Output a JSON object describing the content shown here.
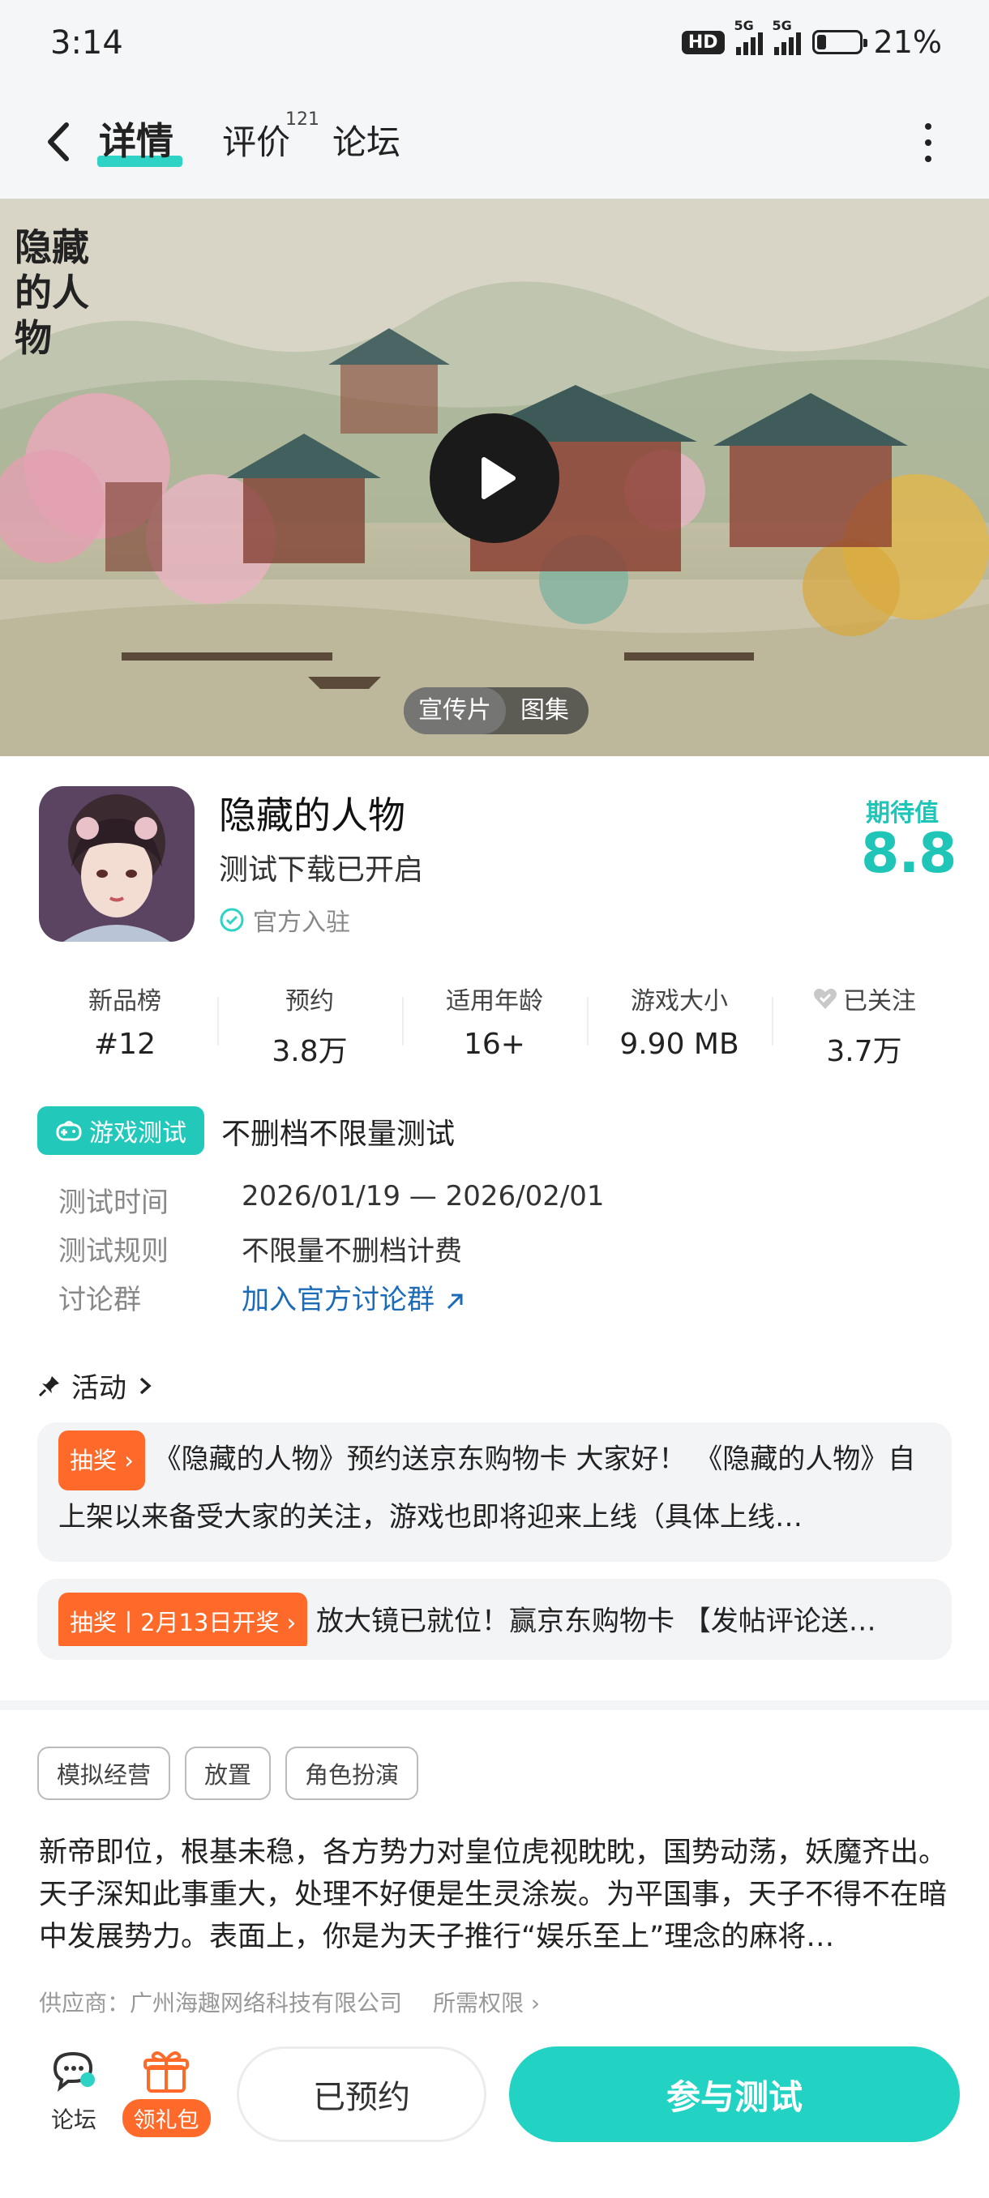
{
  "status_bar": {
    "time": "3:14",
    "hd": "HD",
    "net1": "5G",
    "net2": "5G",
    "battery_percent": 21,
    "battery_text": "21%"
  },
  "nav": {
    "tabs": [
      {
        "label": "详情",
        "active": true
      },
      {
        "label": "评价",
        "count": "121"
      },
      {
        "label": "论坛"
      }
    ]
  },
  "banner": {
    "title_art": "隐藏的人物",
    "media_tabs": [
      "宣传片",
      "图集"
    ]
  },
  "game": {
    "title": "隐藏的人物",
    "subtitle": "测试下载已开启",
    "official": "官方入驻",
    "expect_label": "期待值",
    "expect_value": "8.8"
  },
  "stats": [
    {
      "label": "新品榜",
      "value": "#12"
    },
    {
      "label": "预约",
      "value": "3.8万"
    },
    {
      "label": "适用年龄",
      "value": "16+"
    },
    {
      "label": "游戏大小",
      "value": "9.90 MB"
    },
    {
      "label": "已关注",
      "value": "3.7万"
    }
  ],
  "test": {
    "badge": "游戏测试",
    "headline": "不删档不限量测试",
    "rows": [
      {
        "label": "测试时间",
        "value": "2026/01/19 — 2026/02/01"
      },
      {
        "label": "测试规则",
        "value": "不限量不删档计费"
      },
      {
        "label": "讨论群",
        "value": "加入官方讨论群"
      }
    ]
  },
  "activity": {
    "heading": "活动",
    "items": [
      {
        "tag": "抽奖",
        "text": "《隐藏的人物》预约送京东购物卡 大家好！ 《隐藏的人物》自上架以来备受大家的关注，游戏也即将迎来上线（具体上线…"
      },
      {
        "tag": "抽奖丨2月13日开奖",
        "text": "放大镜已就位！赢京东购物卡 【发帖评论送…"
      }
    ]
  },
  "tags": [
    "模拟经营",
    "放置",
    "角色扮演"
  ],
  "description": "新帝即位，根基未稳，各方势力对皇位虎视眈眈，国势动荡，妖魔齐出。天子深知此事重大，处理不好便是生灵涂炭。为平国事，天子不得不在暗中发展势力。表面上，你是为天子推行“娱乐至上”理念的麻将…",
  "supplier": {
    "text": "供应商：广州海趣网络科技有限公司",
    "permissions": "所需权限"
  },
  "bottom": {
    "forum": "论坛",
    "gift": "领礼包",
    "reserved": "已预约",
    "join": "参与测试"
  },
  "colors": {
    "accent": "#22d3c4",
    "orange": "#ff6a2b",
    "link": "#1c6bb8"
  }
}
